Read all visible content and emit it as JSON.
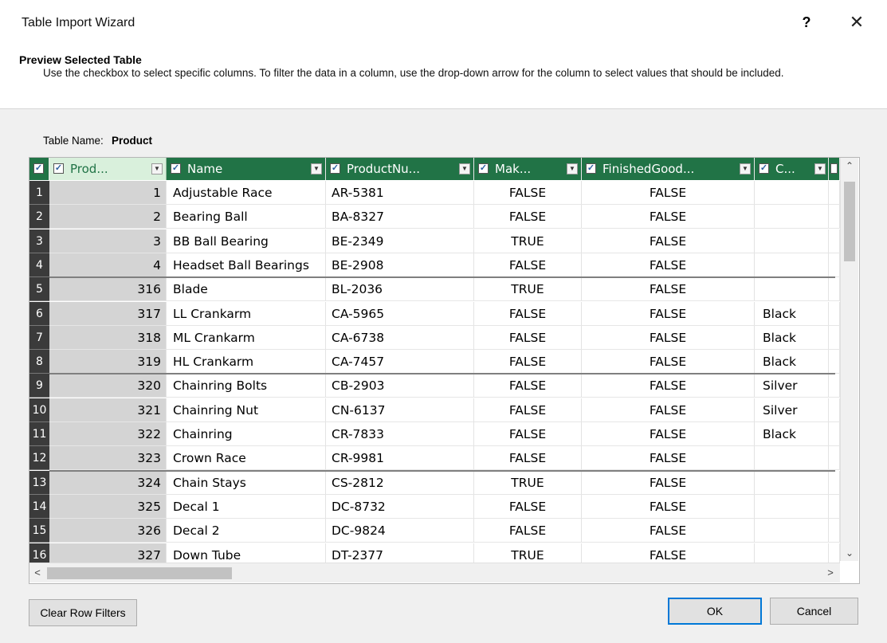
{
  "window": {
    "title": "Table Import Wizard",
    "help": "?",
    "close": "✕"
  },
  "header": {
    "title": "Preview Selected Table",
    "description": "Use the checkbox to select specific columns. To filter the data in a column, use the drop-down arrow  for the column to select values that should be included."
  },
  "table_name": {
    "label": "Table Name:",
    "value": "Product"
  },
  "grid": {
    "all_checkbox": "✓",
    "columns": [
      {
        "label": "Prod..."
      },
      {
        "label": "Name"
      },
      {
        "label": "ProductNu..."
      },
      {
        "label": "Mak..."
      },
      {
        "label": "FinishedGood..."
      },
      {
        "label": "C..."
      }
    ],
    "rows": [
      {
        "num": "1",
        "id": "1",
        "name": "Adjustable Race",
        "code": "AR-5381",
        "make": "FALSE",
        "finished": "FALSE",
        "color": ""
      },
      {
        "num": "2",
        "id": "2",
        "name": "Bearing Ball",
        "code": "BA-8327",
        "make": "FALSE",
        "finished": "FALSE",
        "color": ""
      },
      {
        "num": "3",
        "id": "3",
        "name": "BB Ball Bearing",
        "code": "BE-2349",
        "make": "TRUE",
        "finished": "FALSE",
        "color": ""
      },
      {
        "num": "4",
        "id": "4",
        "name": "Headset Ball Bearings",
        "code": "BE-2908",
        "make": "FALSE",
        "finished": "FALSE",
        "color": ""
      },
      {
        "num": "5",
        "id": "316",
        "name": "Blade",
        "code": "BL-2036",
        "make": "TRUE",
        "finished": "FALSE",
        "color": ""
      },
      {
        "num": "6",
        "id": "317",
        "name": "LL Crankarm",
        "code": "CA-5965",
        "make": "FALSE",
        "finished": "FALSE",
        "color": "Black"
      },
      {
        "num": "7",
        "id": "318",
        "name": "ML Crankarm",
        "code": "CA-6738",
        "make": "FALSE",
        "finished": "FALSE",
        "color": "Black"
      },
      {
        "num": "8",
        "id": "319",
        "name": "HL Crankarm",
        "code": "CA-7457",
        "make": "FALSE",
        "finished": "FALSE",
        "color": "Black"
      },
      {
        "num": "9",
        "id": "320",
        "name": "Chainring Bolts",
        "code": "CB-2903",
        "make": "FALSE",
        "finished": "FALSE",
        "color": "Silver"
      },
      {
        "num": "10",
        "id": "321",
        "name": "Chainring Nut",
        "code": "CN-6137",
        "make": "FALSE",
        "finished": "FALSE",
        "color": "Silver"
      },
      {
        "num": "11",
        "id": "322",
        "name": "Chainring",
        "code": "CR-7833",
        "make": "FALSE",
        "finished": "FALSE",
        "color": "Black"
      },
      {
        "num": "12",
        "id": "323",
        "name": "Crown Race",
        "code": "CR-9981",
        "make": "FALSE",
        "finished": "FALSE",
        "color": ""
      },
      {
        "num": "13",
        "id": "324",
        "name": "Chain Stays",
        "code": "CS-2812",
        "make": "TRUE",
        "finished": "FALSE",
        "color": ""
      },
      {
        "num": "14",
        "id": "325",
        "name": "Decal 1",
        "code": "DC-8732",
        "make": "FALSE",
        "finished": "FALSE",
        "color": ""
      },
      {
        "num": "15",
        "id": "326",
        "name": "Decal 2",
        "code": "DC-9824",
        "make": "FALSE",
        "finished": "FALSE",
        "color": ""
      },
      {
        "num": "16",
        "id": "327",
        "name": "Down Tube",
        "code": "DT-2377",
        "make": "TRUE",
        "finished": "FALSE",
        "color": ""
      }
    ]
  },
  "scroll": {
    "up": "⌃",
    "down": "⌄",
    "left": "<",
    "right": ">"
  },
  "buttons": {
    "clear_filters": "Clear Row Filters",
    "ok": "OK",
    "cancel": "Cancel"
  },
  "colors": {
    "header_green": "#217346",
    "rownum_bg": "#3b3b3b",
    "first_col_bg": "#d4d4d4"
  }
}
